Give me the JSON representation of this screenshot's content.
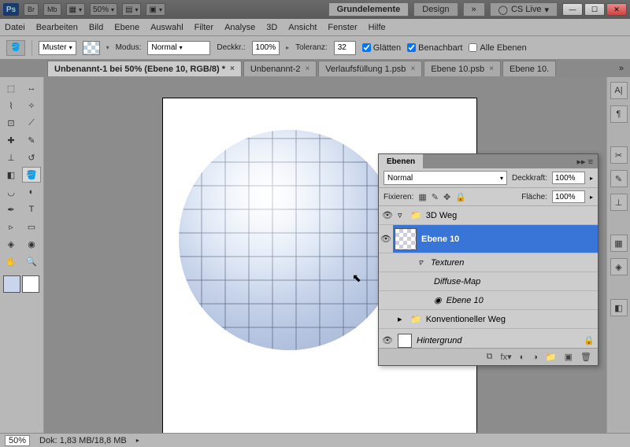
{
  "titlebar": {
    "br": "Br",
    "mb": "Mb",
    "zoom": "50%",
    "ws_primary": "Grundelemente",
    "ws_design": "Design",
    "cslive": "CS Live"
  },
  "menu": [
    "Datei",
    "Bearbeiten",
    "Bild",
    "Ebene",
    "Auswahl",
    "Filter",
    "Analyse",
    "3D",
    "Ansicht",
    "Fenster",
    "Hilfe"
  ],
  "options": {
    "fill": "Muster",
    "mode_lbl": "Modus:",
    "mode": "Normal",
    "opacity_lbl": "Deckkr.:",
    "opacity": "100%",
    "tol_lbl": "Toleranz:",
    "tol": "32",
    "smooth": "Glätten",
    "contig": "Benachbart",
    "all": "Alle Ebenen"
  },
  "tabs": [
    {
      "label": "Unbenannt-1 bei 50% (Ebene 10, RGB/8) *",
      "active": true
    },
    {
      "label": "Unbenannt-2",
      "active": false
    },
    {
      "label": "Verlaufsfüllung 1.psb",
      "active": false
    },
    {
      "label": "Ebene 10.psb",
      "active": false
    },
    {
      "label": "Ebene 10.",
      "active": false
    }
  ],
  "status": {
    "zoom": "50%",
    "doc_lbl": "Dok:",
    "doc": "1,83 MB/18,8 MB"
  },
  "layers": {
    "title": "Ebenen",
    "blend": "Normal",
    "opacity_lbl": "Deckkraft:",
    "opacity": "100%",
    "lock_lbl": "Fixieren:",
    "fill_lbl": "Fläche:",
    "fill": "100%",
    "items": {
      "group": "3D Weg",
      "selected": "Ebene 10",
      "tex": "Texturen",
      "diff": "Diffuse-Map",
      "texlayer": "Ebene 10",
      "group2": "Konventioneller Weg",
      "bg": "Hintergrund"
    }
  },
  "colors": {
    "fg": "#c8d5ed",
    "bg": "#ffffff"
  }
}
